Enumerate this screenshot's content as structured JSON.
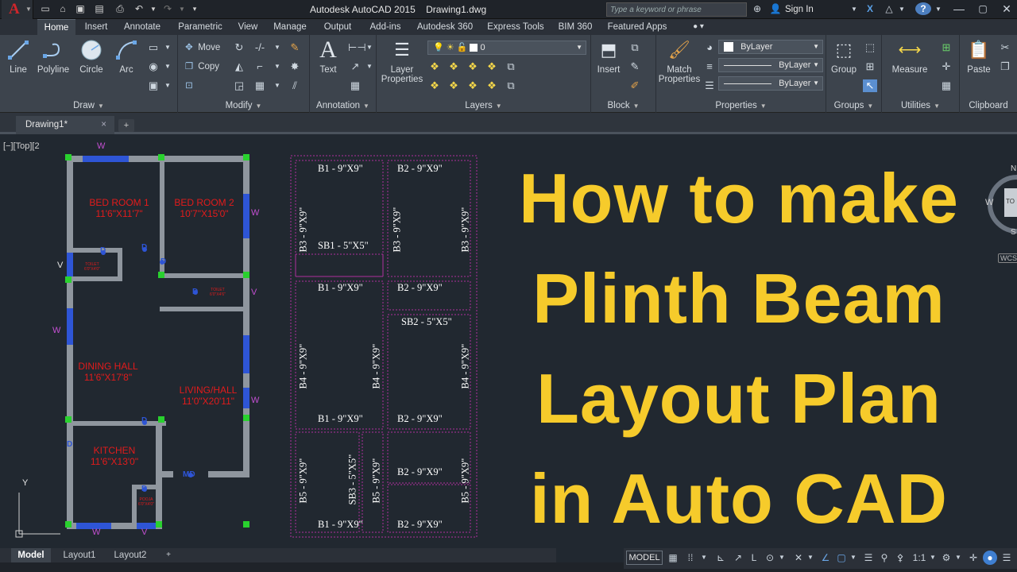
{
  "app": {
    "title": "Autodesk AutoCAD 2015    Drawing1.dwg",
    "logo_letter": "A",
    "search_placeholder": "Type a keyword or phrase",
    "signin_label": "Sign In"
  },
  "ribbon_tabs": [
    "Home",
    "Insert",
    "Annotate",
    "Parametric",
    "View",
    "Manage",
    "Output",
    "Add-ins",
    "Autodesk 360",
    "Express Tools",
    "BIM 360",
    "Featured Apps"
  ],
  "ribbon": {
    "draw": {
      "title": "Draw",
      "line": "Line",
      "polyline": "Polyline",
      "circle": "Circle",
      "arc": "Arc"
    },
    "modify": {
      "title": "Modify",
      "move": "Move",
      "copy": "Copy"
    },
    "annotation": {
      "title": "Annotation",
      "text": "Text"
    },
    "layers": {
      "title": "Layers",
      "layer_properties_1": "Layer",
      "layer_properties_2": "Properties",
      "current_layer": "0"
    },
    "block": {
      "title": "Block",
      "insert": "Insert"
    },
    "properties": {
      "title": "Properties",
      "match_1": "Match",
      "match_2": "Properties",
      "color": "ByLayer",
      "linetype": "ByLayer",
      "lineweight": "ByLayer"
    },
    "groups": {
      "title": "Groups",
      "group": "Group"
    },
    "utilities": {
      "title": "Utilities",
      "measure": "Measure"
    },
    "clipboard": {
      "title": "Clipboard",
      "paste": "Paste"
    }
  },
  "file_tab": {
    "name": "Drawing1*",
    "close": "×",
    "new": "+"
  },
  "viewport_label": "[−][Top][2",
  "floor_plan": {
    "rooms": [
      {
        "name": "BED ROOM 1",
        "size": "11'6\"X11'7\""
      },
      {
        "name": "BED ROOM 2",
        "size": "10'7\"X15'0\""
      },
      {
        "name": "DINING HALL",
        "size": "11'6\"X17'8\""
      },
      {
        "name": "LIVING/HALL",
        "size": "11'0\"X20'11\""
      },
      {
        "name": "KITCHEN",
        "size": "11'6\"X13'0\""
      }
    ],
    "small_rooms": [
      {
        "name": "TOILET",
        "size": "6'0\"X4'0\""
      },
      {
        "name": "TOILET",
        "size": "6'0\"X4'6\""
      },
      {
        "name": "POOJA",
        "size": "6'0\"X4'0\""
      }
    ],
    "marks": {
      "w": "W",
      "v": "V",
      "d": "D",
      "md": "MD"
    }
  },
  "beam_layout": {
    "labels": {
      "b1": "B1 - 9\"X9\"",
      "b2": "B2 - 9\"X9\"",
      "b3": "B3 - 9\"X9\"",
      "b4": "B4 - 9\"X9\"",
      "b5": "B5 - 9\"X9\"",
      "sb1": "SB1 - 5\"X5\"",
      "sb2": "SB2 - 5\"X5\"",
      "sb3": "SB3 - 5\"X5\""
    }
  },
  "headline": [
    "How to make",
    "Plinth Beam",
    "Layout Plan",
    "in Auto CAD"
  ],
  "viewcube": {
    "w": "W",
    "s": "S",
    "n": "N",
    "top": "TO",
    "wcs": "WCS"
  },
  "ucs": {
    "y": "Y"
  },
  "layout_tabs": [
    "Model",
    "Layout1",
    "Layout2"
  ],
  "status": {
    "model": "MODEL",
    "scale": "1:1"
  },
  "colors": {
    "headline": "#f6cb2b",
    "room_text": "#e21b1b",
    "window_mark": "#c34fd1",
    "door_mark": "#2e55d6",
    "grip": "#29d12e",
    "beam_dash": "#b0309e"
  }
}
